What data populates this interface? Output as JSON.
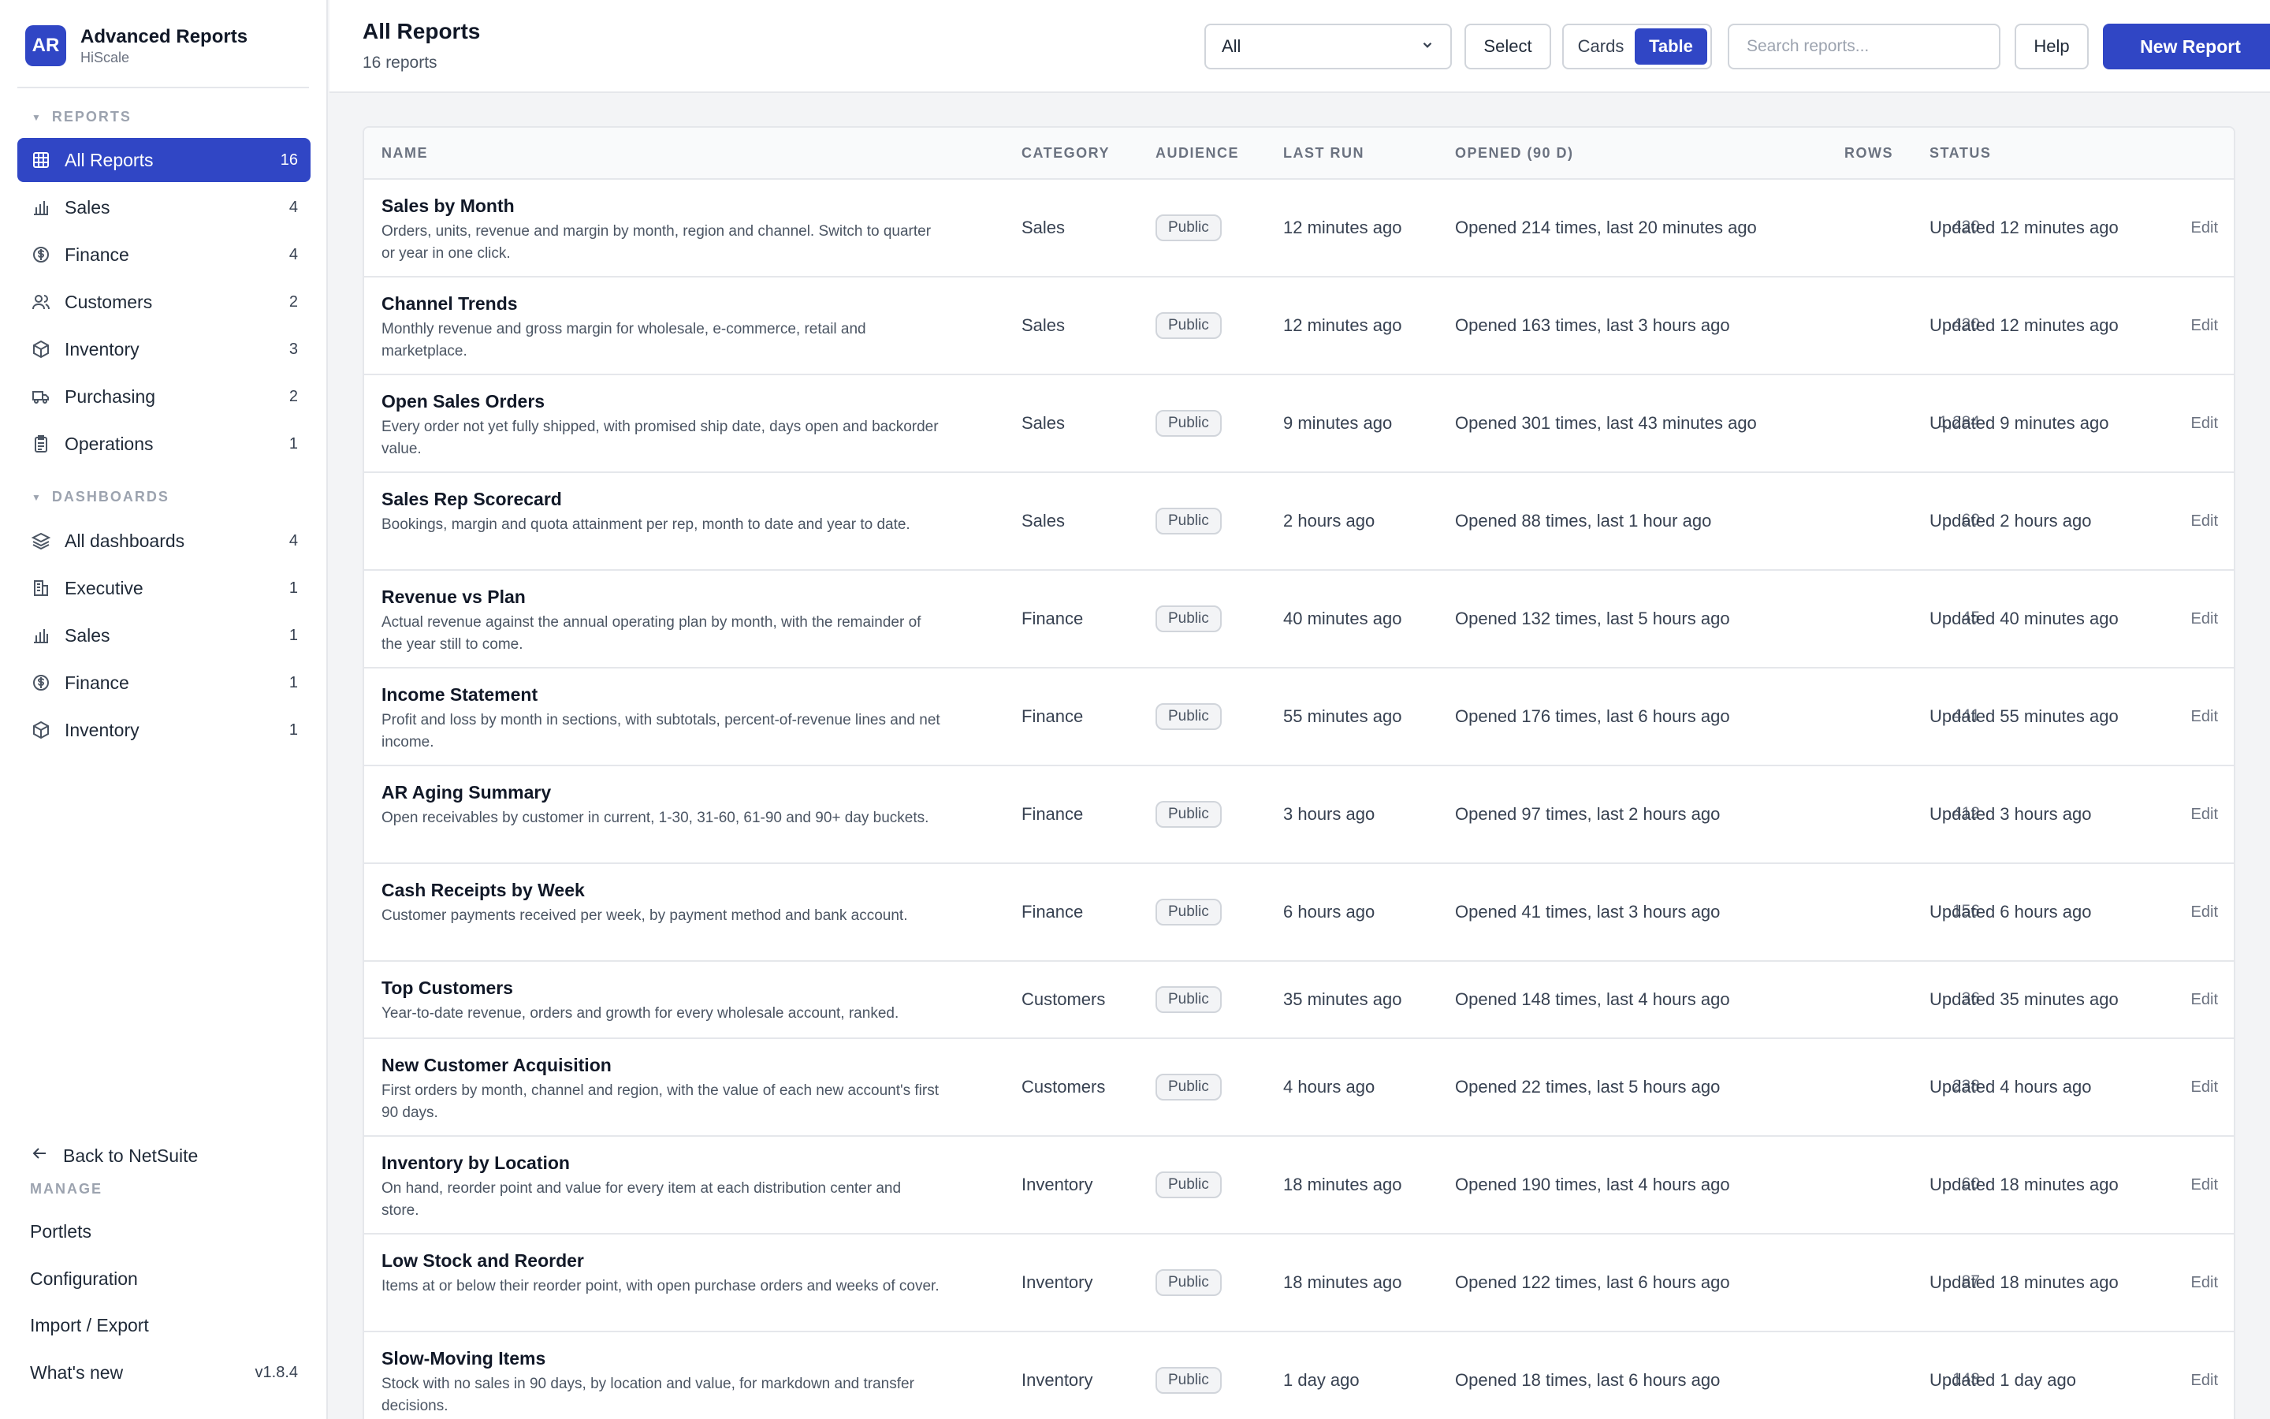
{
  "brand": {
    "logo": "AR",
    "title": "Advanced Reports",
    "subtitle": "HiScale"
  },
  "sidebar": {
    "reports_label": "REPORTS",
    "reports": [
      {
        "label": "All Reports",
        "count": "16",
        "icon": "grid-icon",
        "active": true
      },
      {
        "label": "Sales",
        "count": "4",
        "icon": "bar-chart-icon"
      },
      {
        "label": "Finance",
        "count": "4",
        "icon": "dollar-icon"
      },
      {
        "label": "Customers",
        "count": "2",
        "icon": "users-icon"
      },
      {
        "label": "Inventory",
        "count": "3",
        "icon": "box-icon"
      },
      {
        "label": "Purchasing",
        "count": "2",
        "icon": "truck-icon"
      },
      {
        "label": "Operations",
        "count": "1",
        "icon": "clipboard-icon"
      }
    ],
    "dashboards_label": "DASHBOARDS",
    "dashboards": [
      {
        "label": "All dashboards",
        "count": "4",
        "icon": "layers-icon"
      },
      {
        "label": "Executive",
        "count": "1",
        "icon": "building-icon"
      },
      {
        "label": "Sales",
        "count": "1",
        "icon": "bar-chart-icon"
      },
      {
        "label": "Finance",
        "count": "1",
        "icon": "dollar-icon"
      },
      {
        "label": "Inventory",
        "count": "1",
        "icon": "box-icon"
      }
    ],
    "back_label": "Back to NetSuite",
    "manage_label": "MANAGE",
    "manage": [
      {
        "label": "Portlets"
      },
      {
        "label": "Configuration"
      },
      {
        "label": "Import / Export"
      },
      {
        "label": "What's new",
        "version": "v1.8.4"
      }
    ]
  },
  "header": {
    "title": "All Reports",
    "subtitle": "16 reports",
    "filter_value": "All",
    "select_label": "Select",
    "view_cards": "Cards",
    "view_table": "Table",
    "search_placeholder": "Search reports...",
    "help_label": "Help",
    "new_label": "New Report"
  },
  "table": {
    "columns": {
      "name": "NAME",
      "category": "CATEGORY",
      "audience": "AUDIENCE",
      "last_run": "LAST RUN",
      "opened": "OPENED (90 D)",
      "rows": "ROWS",
      "status": "STATUS"
    },
    "edit_label": "Edit",
    "rows": [
      {
        "title": "Sales by Month",
        "desc": "Orders, units, revenue and margin by month, region and channel. Switch to quarter or year in one click.",
        "category": "Sales",
        "audience": "Public",
        "last_run": "12 minutes ago",
        "opened": "Opened 214 times, last 20 minutes ago",
        "rows": "420",
        "status": "Updated 12 minutes ago"
      },
      {
        "title": "Channel Trends",
        "desc": "Monthly revenue and gross margin for wholesale, e-commerce, retail and marketplace.",
        "category": "Sales",
        "audience": "Public",
        "last_run": "12 minutes ago",
        "opened": "Opened 163 times, last 3 hours ago",
        "rows": "420",
        "status": "Updated 12 minutes ago"
      },
      {
        "title": "Open Sales Orders",
        "desc": "Every order not yet fully shipped, with promised ship date, days open and backorder value.",
        "category": "Sales",
        "audience": "Public",
        "last_run": "9 minutes ago",
        "opened": "Opened 301 times, last 43 minutes ago",
        "rows": "1,284",
        "status": "Updated 9 minutes ago"
      },
      {
        "title": "Sales Rep Scorecard",
        "desc": "Bookings, margin and quota attainment per rep, month to date and year to date.",
        "category": "Sales",
        "audience": "Public",
        "last_run": "2 hours ago",
        "opened": "Opened 88 times, last 1 hour ago",
        "rows": "60",
        "status": "Updated 2 hours ago"
      },
      {
        "title": "Revenue vs Plan",
        "desc": "Actual revenue against the annual operating plan by month, with the remainder of the year still to come.",
        "category": "Finance",
        "audience": "Public",
        "last_run": "40 minutes ago",
        "opened": "Opened 132 times, last 5 hours ago",
        "rows": "45",
        "status": "Updated 40 minutes ago"
      },
      {
        "title": "Income Statement",
        "desc": "Profit and loss by month in sections, with subtotals, percent-of-revenue lines and net income.",
        "category": "Finance",
        "audience": "Public",
        "last_run": "55 minutes ago",
        "opened": "Opened 176 times, last 6 hours ago",
        "rows": "441",
        "status": "Updated 55 minutes ago"
      },
      {
        "title": "AR Aging Summary",
        "desc": "Open receivables by customer in current, 1-30, 31-60, 61-90 and 90+ day buckets.",
        "category": "Finance",
        "audience": "Public",
        "last_run": "3 hours ago",
        "opened": "Opened 97 times, last 2 hours ago",
        "rows": "412",
        "status": "Updated 3 hours ago"
      },
      {
        "title": "Cash Receipts by Week",
        "desc": "Customer payments received per week, by payment method and bank account.",
        "category": "Finance",
        "audience": "Public",
        "last_run": "6 hours ago",
        "opened": "Opened 41 times, last 3 hours ago",
        "rows": "156",
        "status": "Updated 6 hours ago"
      },
      {
        "title": "Top Customers",
        "desc": "Year-to-date revenue, orders and growth for every wholesale account, ranked.",
        "category": "Customers",
        "audience": "Public",
        "last_run": "35 minutes ago",
        "opened": "Opened 148 times, last 4 hours ago",
        "rows": "36",
        "status": "Updated 35 minutes ago"
      },
      {
        "title": "New Customer Acquisition",
        "desc": "First orders by month, channel and region, with the value of each new account's first 90 days.",
        "category": "Customers",
        "audience": "Public",
        "last_run": "4 hours ago",
        "opened": "Opened 22 times, last 5 hours ago",
        "rows": "238",
        "status": "Updated 4 hours ago"
      },
      {
        "title": "Inventory by Location",
        "desc": "On hand, reorder point and value for every item at each distribution center and store.",
        "category": "Inventory",
        "audience": "Public",
        "last_run": "18 minutes ago",
        "opened": "Opened 190 times, last 4 hours ago",
        "rows": "60",
        "status": "Updated 18 minutes ago"
      },
      {
        "title": "Low Stock and Reorder",
        "desc": "Items at or below their reorder point, with open purchase orders and weeks of cover.",
        "category": "Inventory",
        "audience": "Public",
        "last_run": "18 minutes ago",
        "opened": "Opened 122 times, last 6 hours ago",
        "rows": "87",
        "status": "Updated 18 minutes ago"
      },
      {
        "title": "Slow-Moving Items",
        "desc": "Stock with no sales in 90 days, by location and value, for markdown and transfer decisions.",
        "category": "Inventory",
        "audience": "Public",
        "last_run": "1 day ago",
        "opened": "Opened 18 times, last 6 hours ago",
        "rows": "143",
        "status": "Updated 1 day ago"
      }
    ]
  },
  "colors": {
    "accent": "#3046c5",
    "border": "#e5e7eb",
    "muted": "#6b7280"
  }
}
